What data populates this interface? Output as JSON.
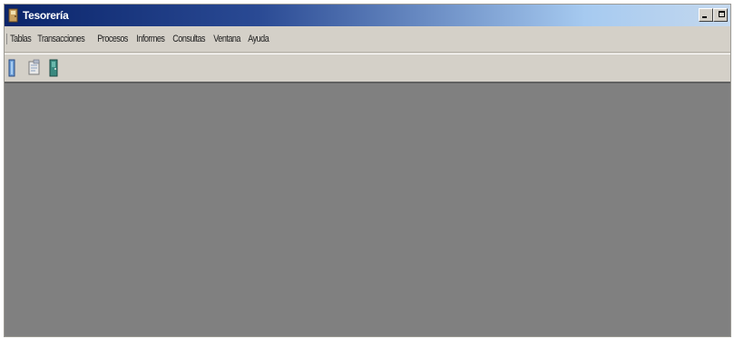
{
  "window": {
    "title": "Tesorería"
  },
  "menubar": {
    "items": [
      {
        "label": "Tablas"
      },
      {
        "label": "Transacciones"
      },
      {
        "label": "Procesos"
      },
      {
        "label": "Informes"
      },
      {
        "label": "Consultas"
      },
      {
        "label": "Ventana"
      },
      {
        "label": "Ayuda"
      }
    ]
  },
  "toolbar": {
    "icons": [
      "door-icon",
      "notepad-icon",
      "exit-door-icon"
    ]
  },
  "colors": {
    "titlebar_start": "#0a246a",
    "titlebar_end": "#c4d8ee",
    "chrome": "#d4d0c8",
    "workspace": "#808080"
  }
}
